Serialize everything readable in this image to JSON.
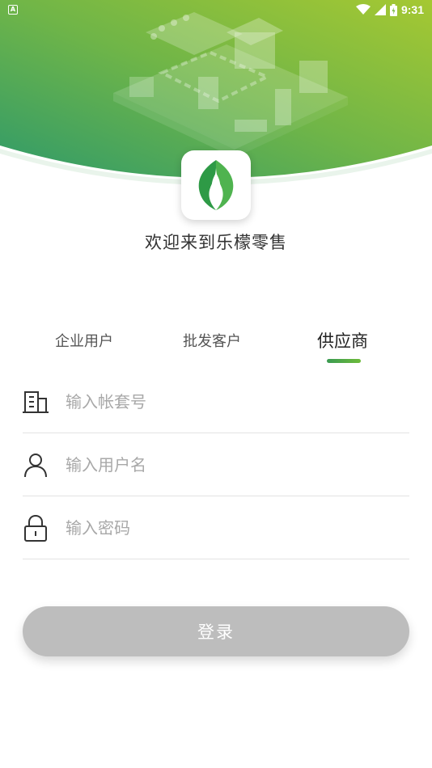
{
  "status_bar": {
    "notification_icon": "A",
    "time": "9:31",
    "icons": [
      "wifi-icon",
      "signal-icon",
      "battery-icon"
    ]
  },
  "welcome_text": "欢迎来到乐檬零售",
  "tabs": [
    {
      "label": "企业用户",
      "active": false
    },
    {
      "label": "批发客户",
      "active": false
    },
    {
      "label": "供应商",
      "active": true
    }
  ],
  "fields": {
    "account": {
      "placeholder": "输入帐套号",
      "value": "",
      "icon": "building-icon"
    },
    "username": {
      "placeholder": "输入用户名",
      "value": "",
      "icon": "user-icon"
    },
    "password": {
      "placeholder": "输入密码",
      "value": "",
      "icon": "lock-icon"
    }
  },
  "login_button": "登录",
  "colors": {
    "brand_green": "#3a9a52",
    "brand_lime": "#9cc43a",
    "button_disabled": "#bdbdbd"
  }
}
